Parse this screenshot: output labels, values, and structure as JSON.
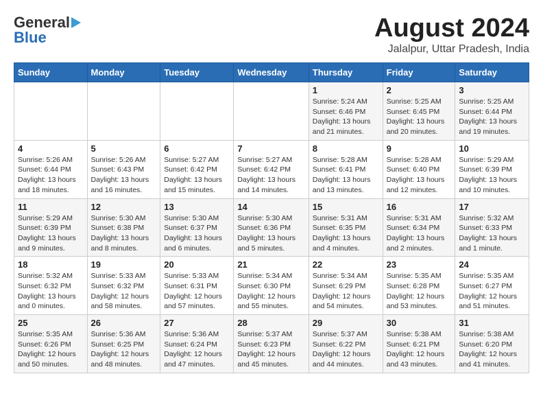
{
  "logo": {
    "general": "General",
    "blue": "Blue"
  },
  "header": {
    "month_year": "August 2024",
    "location": "Jalalpur, Uttar Pradesh, India"
  },
  "days_of_week": [
    "Sunday",
    "Monday",
    "Tuesday",
    "Wednesday",
    "Thursday",
    "Friday",
    "Saturday"
  ],
  "weeks": [
    [
      {
        "day": "",
        "info": ""
      },
      {
        "day": "",
        "info": ""
      },
      {
        "day": "",
        "info": ""
      },
      {
        "day": "",
        "info": ""
      },
      {
        "day": "1",
        "info": "Sunrise: 5:24 AM\nSunset: 6:46 PM\nDaylight: 13 hours\nand 21 minutes."
      },
      {
        "day": "2",
        "info": "Sunrise: 5:25 AM\nSunset: 6:45 PM\nDaylight: 13 hours\nand 20 minutes."
      },
      {
        "day": "3",
        "info": "Sunrise: 5:25 AM\nSunset: 6:44 PM\nDaylight: 13 hours\nand 19 minutes."
      }
    ],
    [
      {
        "day": "4",
        "info": "Sunrise: 5:26 AM\nSunset: 6:44 PM\nDaylight: 13 hours\nand 18 minutes."
      },
      {
        "day": "5",
        "info": "Sunrise: 5:26 AM\nSunset: 6:43 PM\nDaylight: 13 hours\nand 16 minutes."
      },
      {
        "day": "6",
        "info": "Sunrise: 5:27 AM\nSunset: 6:42 PM\nDaylight: 13 hours\nand 15 minutes."
      },
      {
        "day": "7",
        "info": "Sunrise: 5:27 AM\nSunset: 6:42 PM\nDaylight: 13 hours\nand 14 minutes."
      },
      {
        "day": "8",
        "info": "Sunrise: 5:28 AM\nSunset: 6:41 PM\nDaylight: 13 hours\nand 13 minutes."
      },
      {
        "day": "9",
        "info": "Sunrise: 5:28 AM\nSunset: 6:40 PM\nDaylight: 13 hours\nand 12 minutes."
      },
      {
        "day": "10",
        "info": "Sunrise: 5:29 AM\nSunset: 6:39 PM\nDaylight: 13 hours\nand 10 minutes."
      }
    ],
    [
      {
        "day": "11",
        "info": "Sunrise: 5:29 AM\nSunset: 6:39 PM\nDaylight: 13 hours\nand 9 minutes."
      },
      {
        "day": "12",
        "info": "Sunrise: 5:30 AM\nSunset: 6:38 PM\nDaylight: 13 hours\nand 8 minutes."
      },
      {
        "day": "13",
        "info": "Sunrise: 5:30 AM\nSunset: 6:37 PM\nDaylight: 13 hours\nand 6 minutes."
      },
      {
        "day": "14",
        "info": "Sunrise: 5:30 AM\nSunset: 6:36 PM\nDaylight: 13 hours\nand 5 minutes."
      },
      {
        "day": "15",
        "info": "Sunrise: 5:31 AM\nSunset: 6:35 PM\nDaylight: 13 hours\nand 4 minutes."
      },
      {
        "day": "16",
        "info": "Sunrise: 5:31 AM\nSunset: 6:34 PM\nDaylight: 13 hours\nand 2 minutes."
      },
      {
        "day": "17",
        "info": "Sunrise: 5:32 AM\nSunset: 6:33 PM\nDaylight: 13 hours\nand 1 minute."
      }
    ],
    [
      {
        "day": "18",
        "info": "Sunrise: 5:32 AM\nSunset: 6:32 PM\nDaylight: 13 hours\nand 0 minutes."
      },
      {
        "day": "19",
        "info": "Sunrise: 5:33 AM\nSunset: 6:32 PM\nDaylight: 12 hours\nand 58 minutes."
      },
      {
        "day": "20",
        "info": "Sunrise: 5:33 AM\nSunset: 6:31 PM\nDaylight: 12 hours\nand 57 minutes."
      },
      {
        "day": "21",
        "info": "Sunrise: 5:34 AM\nSunset: 6:30 PM\nDaylight: 12 hours\nand 55 minutes."
      },
      {
        "day": "22",
        "info": "Sunrise: 5:34 AM\nSunset: 6:29 PM\nDaylight: 12 hours\nand 54 minutes."
      },
      {
        "day": "23",
        "info": "Sunrise: 5:35 AM\nSunset: 6:28 PM\nDaylight: 12 hours\nand 53 minutes."
      },
      {
        "day": "24",
        "info": "Sunrise: 5:35 AM\nSunset: 6:27 PM\nDaylight: 12 hours\nand 51 minutes."
      }
    ],
    [
      {
        "day": "25",
        "info": "Sunrise: 5:35 AM\nSunset: 6:26 PM\nDaylight: 12 hours\nand 50 minutes."
      },
      {
        "day": "26",
        "info": "Sunrise: 5:36 AM\nSunset: 6:25 PM\nDaylight: 12 hours\nand 48 minutes."
      },
      {
        "day": "27",
        "info": "Sunrise: 5:36 AM\nSunset: 6:24 PM\nDaylight: 12 hours\nand 47 minutes."
      },
      {
        "day": "28",
        "info": "Sunrise: 5:37 AM\nSunset: 6:23 PM\nDaylight: 12 hours\nand 45 minutes."
      },
      {
        "day": "29",
        "info": "Sunrise: 5:37 AM\nSunset: 6:22 PM\nDaylight: 12 hours\nand 44 minutes."
      },
      {
        "day": "30",
        "info": "Sunrise: 5:38 AM\nSunset: 6:21 PM\nDaylight: 12 hours\nand 43 minutes."
      },
      {
        "day": "31",
        "info": "Sunrise: 5:38 AM\nSunset: 6:20 PM\nDaylight: 12 hours\nand 41 minutes."
      }
    ]
  ]
}
